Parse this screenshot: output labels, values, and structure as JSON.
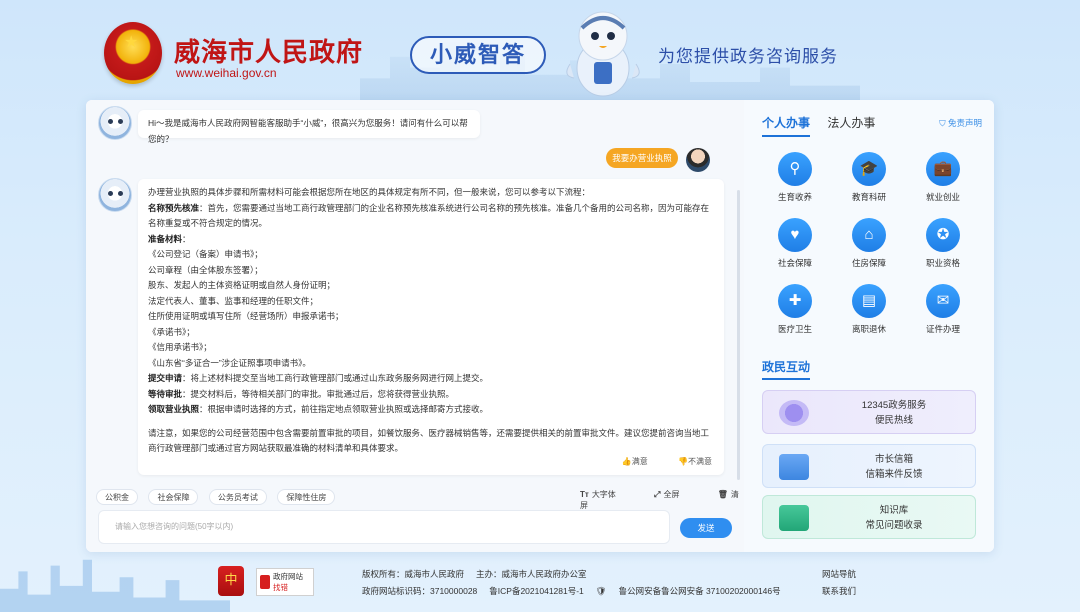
{
  "header": {
    "gov_name": "威海市人民政府",
    "gov_url": "www.weihai.gov.cn",
    "brand": "小威智答",
    "slogan": "为您提供政务咨询服务"
  },
  "chat": {
    "greeting": "Hi～我是威海市人民政府网智能客服助手“小威”，很高兴为您服务！请问有什么可以帮您的？",
    "user_message": "我要办营业执照",
    "answer": {
      "intro": "办理营业执照的具体步骤和所需材料可能会根据您所在地区的具体规定有所不同，但一般来说，您可以参考以下流程：",
      "step1_label": "名称预先核准",
      "step1_text": "：首先，您需要通过当地工商行政管理部门的企业名称预先核准系统进行公司名称的预先核准。准备几个备用的公司名称，因为可能存在名称重复或不符合规定的情况。",
      "materials_label": "准备材料",
      "materials_colon": "：",
      "materials": [
        "《公司登记（备案）申请书》；",
        "公司章程（由全体股东签署）；",
        "股东、发起人的主体资格证明或自然人身份证明；",
        "法定代表人、董事、监事和经理的任职文件；",
        "住所使用证明或填写住所（经营场所）申报承诺书；",
        "《承诺书》；",
        "《信用承诺书》；",
        "《山东省“多证合一”涉企证照事项申请书》。"
      ],
      "step3_label": "提交申请",
      "step3_text": "：将上述材料提交至当地工商行政管理部门或通过山东政务服务网进行网上提交。",
      "step4_label": "等待审批",
      "step4_text": "：提交材料后，等待相关部门的审批。审批通过后，您将获得营业执照。",
      "step5_label": "领取营业执照",
      "step5_text": "：根据申请时选择的方式，前往指定地点领取营业执照或选择邮寄方式接收。",
      "note": "请注意，如果您的公司经营范围中包含需要前置审批的项目，如餐饮服务、医疗器械销售等，还需要提供相关的前置审批文件。建议您提前咨询当地工商行政管理部门或通过官方网站获取最准确的材料清单和具体要求。",
      "satisfied": "满意",
      "unsatisfied": "不满意"
    },
    "quick_chips": [
      "公积金",
      "社会保障",
      "公务员考试",
      "保障性住房"
    ],
    "tools": {
      "font": "大字体",
      "fullscreen": "全屏",
      "clear": "清屏"
    },
    "input_placeholder": "请输入您想咨询的问题(50字以内)",
    "send_label": "发送"
  },
  "side": {
    "tabs": [
      "个人办事",
      "法人办事"
    ],
    "disclaimer": "免责声明",
    "services": [
      {
        "label": "生育收养",
        "icon": "family-icon"
      },
      {
        "label": "教育科研",
        "icon": "graduation-cap-icon"
      },
      {
        "label": "就业创业",
        "icon": "briefcase-icon"
      },
      {
        "label": "社会保障",
        "icon": "hands-shield-icon"
      },
      {
        "label": "住房保障",
        "icon": "house-icon"
      },
      {
        "label": "职业资格",
        "icon": "medal-icon"
      },
      {
        "label": "医疗卫生",
        "icon": "hospital-icon"
      },
      {
        "label": "离职退休",
        "icon": "id-card-icon"
      },
      {
        "label": "证件办理",
        "icon": "certificate-icon"
      }
    ],
    "interaction_title": "政民互动",
    "cards": [
      {
        "line1": "12345政务服务",
        "line2": "便民热线",
        "icon": "phone-12345-icon"
      },
      {
        "line1": "市长信箱",
        "line2": "信箱来件反馈",
        "icon": "mailbox-icon"
      },
      {
        "line1": "知识库",
        "line2": "常见问题收录",
        "icon": "book-icon"
      }
    ]
  },
  "footer": {
    "party_logo_text": "中",
    "error_logo_line1": "政府网站",
    "error_logo_line2": "找错",
    "copyright": "版权所有：威海市人民政府",
    "host": "主办：威海市人民政府办公室",
    "site_id": "政府网站标识码：3710000028",
    "icp": "鲁ICP备2021041281号-1",
    "police": "鲁公网安备鲁公网安备 37100202000146号",
    "nav": "网站导航",
    "contact": "联系我们"
  }
}
